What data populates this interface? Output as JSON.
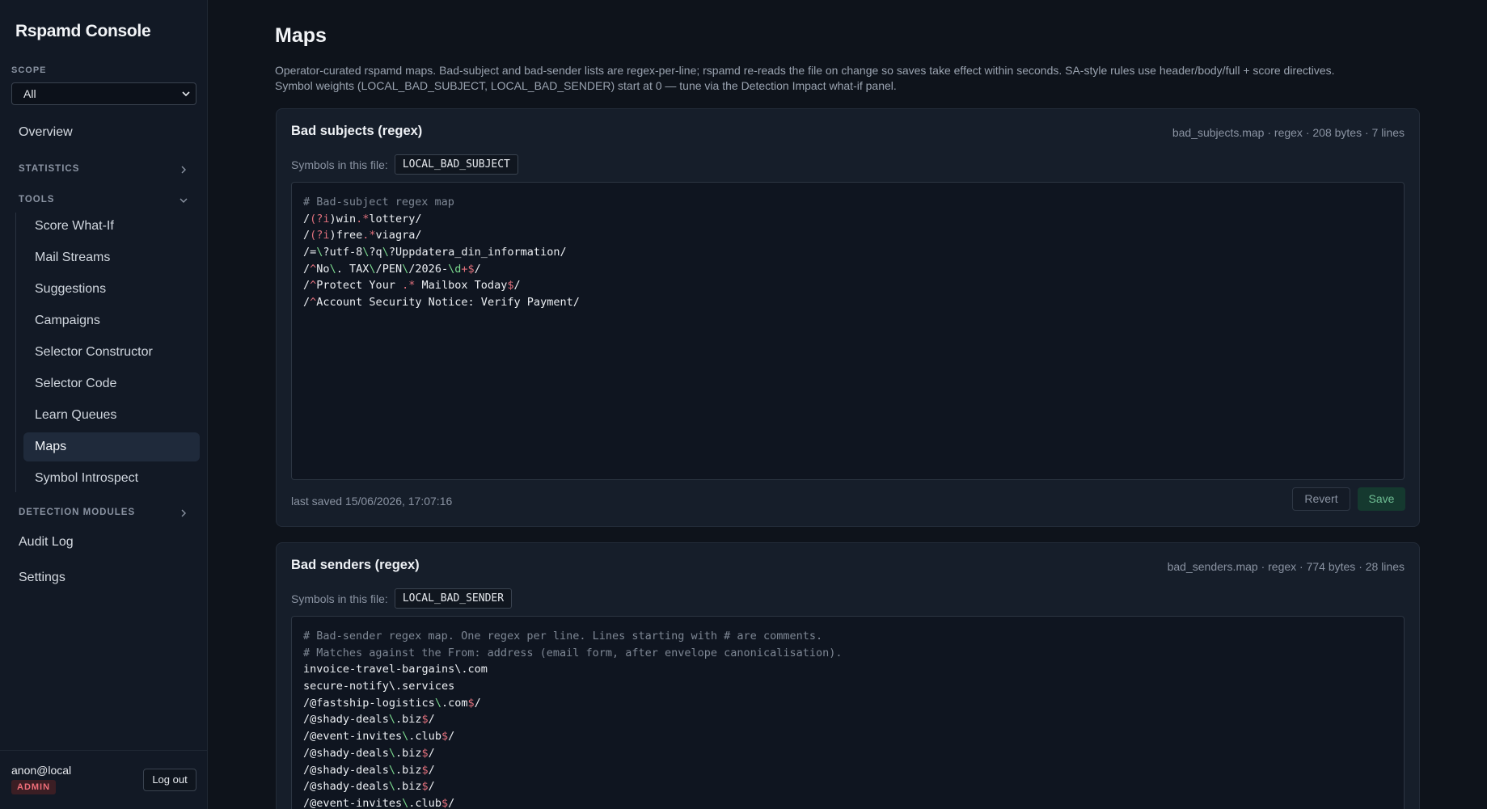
{
  "app": {
    "title": "Rspamd Console"
  },
  "sidebar": {
    "scope_label": "SCOPE",
    "scope_value": "All",
    "overview": "Overview",
    "statistics_label": "STATISTICS",
    "tools_label": "TOOLS",
    "tools": [
      {
        "label": "Score What-If"
      },
      {
        "label": "Mail Streams"
      },
      {
        "label": "Suggestions"
      },
      {
        "label": "Campaigns"
      },
      {
        "label": "Selector Constructor"
      },
      {
        "label": "Selector Code"
      },
      {
        "label": "Learn Queues"
      },
      {
        "label": "Maps",
        "active": true
      },
      {
        "label": "Symbol Introspect"
      }
    ],
    "detection_label": "DETECTION MODULES",
    "audit_log": "Audit Log",
    "settings": "Settings",
    "user": "anon@local",
    "role": "ADMIN",
    "logout": "Log out"
  },
  "page": {
    "title": "Maps",
    "description_line1": "Operator-curated rspamd maps. Bad-subject and bad-sender lists are regex-per-line; rspamd re-reads the file on change so saves take effect within seconds. SA-style rules use header/body/full + score directives.",
    "description_line2": "Symbol weights (LOCAL_BAD_SUBJECT, LOCAL_BAD_SENDER) start at 0 — tune via the Detection Impact what-if panel."
  },
  "maps": [
    {
      "title": "Bad subjects (regex)",
      "meta": "bad_subjects.map · regex · 208 bytes · 7 lines",
      "symbols_label": "Symbols in this file:",
      "symbol": "LOCAL_BAD_SUBJECT",
      "lines": [
        "# Bad-subject regex map",
        "/(?i)win.*lottery/",
        "/(?i)free.*viagra/",
        "/=\\?utf-8\\?q\\?Uppdatera_din_information/",
        "/^No\\. TAX\\/PEN\\/2026-\\d+$/",
        "/^Protect Your .* Mailbox Today$/",
        "/^Account Security Notice: Verify Payment/"
      ],
      "last_saved": "last saved 15/06/2026, 17:07:16",
      "revert": "Revert",
      "save": "Save"
    },
    {
      "title": "Bad senders (regex)",
      "meta": "bad_senders.map · regex · 774 bytes · 28 lines",
      "symbols_label": "Symbols in this file:",
      "symbol": "LOCAL_BAD_SENDER",
      "lines": [
        "# Bad-sender regex map. One regex per line. Lines starting with # are comments.",
        "# Matches against the From: address (email form, after envelope canonicalisation).",
        "invoice-travel-bargains\\.com",
        "secure-notify\\.services",
        "/@fastship-logistics\\.com$/",
        "/@shady-deals\\.biz$/",
        "/@event-invites\\.club$/",
        "/@shady-deals\\.biz$/",
        "/@shady-deals\\.biz$/",
        "/@shady-deals\\.biz$/",
        "/@event-invites\\.club$/"
      ]
    }
  ],
  "colors": {
    "background": "#0e131b",
    "sidebar": "#121925",
    "card": "#161e2a",
    "editor": "#0f1520",
    "regex_meta": "#e0707c",
    "regex_escape": "#7bd98e",
    "admin_badge": "#ef6e79",
    "save_accent": "#6fbf94"
  }
}
